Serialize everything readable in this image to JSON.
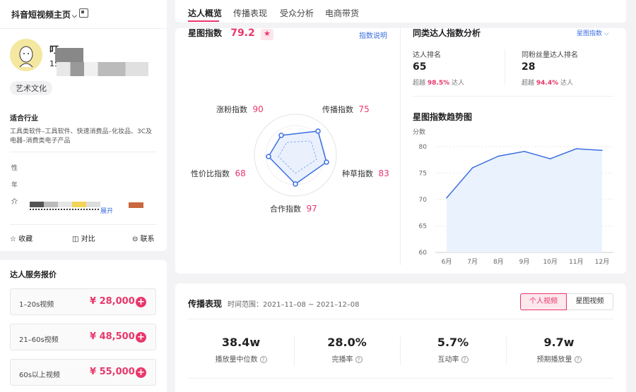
{
  "sidebar": {
    "account_select": "抖音短视频主页",
    "name_initial": "叮",
    "id_initial": "15",
    "tag": "艺术文化",
    "industry_title": "适合行业",
    "industry_text_line1": "工具类软件–工具软件、快速消费品–化妆品、3C及",
    "industry_text_line2": "电器–消费类电子产品",
    "info_labels": [
      "性",
      "年",
      "介"
    ],
    "expand": "展开",
    "actions": {
      "collect": "收藏",
      "compare": "对比",
      "contact": "联系"
    },
    "price_title": "达人服务报价",
    "prices": [
      {
        "label": "1–20s视频",
        "price": "¥ 28,000"
      },
      {
        "label": "21–60s视频",
        "price": "¥ 48,500"
      },
      {
        "label": "60s以上视频",
        "price": "¥ 55,000"
      }
    ]
  },
  "tabs": [
    "达人概览",
    "传播表现",
    "受众分析",
    "电商带货"
  ],
  "star_index": {
    "title": "星图指数",
    "value": "79.2",
    "help_link": "指数说明",
    "radar": [
      {
        "label": "涨粉指数",
        "value": "90"
      },
      {
        "label": "传播指数",
        "value": "75"
      },
      {
        "label": "种草指数",
        "value": "83"
      },
      {
        "label": "合作指数",
        "value": "97"
      },
      {
        "label": "性价比指数",
        "value": "68"
      }
    ]
  },
  "peer": {
    "title": "同类达人指数分析",
    "link": "星图指数",
    "rank": {
      "label": "达人排名",
      "value": "65",
      "prefix": "超越",
      "pct": "98.5%",
      "suffix": "达人"
    },
    "fans_rank": {
      "label": "同粉丝量达人排名",
      "value": "28",
      "prefix": "超越",
      "pct": "94.4%",
      "suffix": "达人"
    }
  },
  "trend": {
    "title": "星图指数趋势图",
    "unit": "分数"
  },
  "chart_data": {
    "type": "area",
    "title": "星图指数趋势图",
    "ylabel": "分数",
    "categories": [
      "6月",
      "7月",
      "8月",
      "9月",
      "10月",
      "11月",
      "12月"
    ],
    "values": [
      70.3,
      76.0,
      78.2,
      79.1,
      77.7,
      79.6,
      79.3
    ],
    "yticks": [
      "80",
      "75",
      "70",
      "65",
      "60"
    ],
    "ylim": [
      60,
      80
    ],
    "grid": true,
    "color": "#3b6fe0"
  },
  "performance": {
    "title": "传播表现",
    "range_label": "时间范围：",
    "range": "2021–11–08 ~ 2021–12–08",
    "toggle": [
      "个人视频",
      "星图视频"
    ],
    "stats": [
      {
        "value": "38.4w",
        "label": "播放量中位数"
      },
      {
        "value": "28.0%",
        "label": "完播率"
      },
      {
        "value": "5.7%",
        "label": "互动率"
      },
      {
        "value": "9.7w",
        "label": "预期播放量"
      }
    ]
  },
  "colors": {
    "accent": "#e8376b",
    "chart": "#3b6fe0"
  }
}
